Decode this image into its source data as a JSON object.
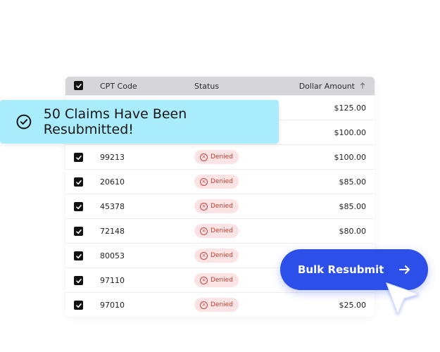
{
  "table": {
    "headers": {
      "code": "CPT Code",
      "status": "Status",
      "amount": "Dollar Amount"
    },
    "rows": [
      {
        "code": "",
        "status": "",
        "amount": "$125.00"
      },
      {
        "code": "",
        "status": "",
        "amount": "$100.00"
      },
      {
        "code": "99213",
        "status": "Denied",
        "amount": "$100.00"
      },
      {
        "code": "20610",
        "status": "Denied",
        "amount": "$85.00"
      },
      {
        "code": "45378",
        "status": "Denied",
        "amount": "$85.00"
      },
      {
        "code": "72148",
        "status": "Denied",
        "amount": "$80.00"
      },
      {
        "code": "80053",
        "status": "Denied",
        "amount": ""
      },
      {
        "code": "97110",
        "status": "Denied",
        "amount": ""
      },
      {
        "code": "97010",
        "status": "Denied",
        "amount": "$25.00"
      }
    ]
  },
  "toast": {
    "message": "50 Claims Have Been Resubmitted!",
    "icon": "check-circle-icon"
  },
  "bulk_button": {
    "label": "Bulk Resubmit",
    "icon": "arrow-right-icon"
  },
  "colors": {
    "accent": "#2b4fe8",
    "toast_bg": "#a9ecfb",
    "denied_bg": "#fde4e4",
    "denied_text": "#c0392b"
  }
}
